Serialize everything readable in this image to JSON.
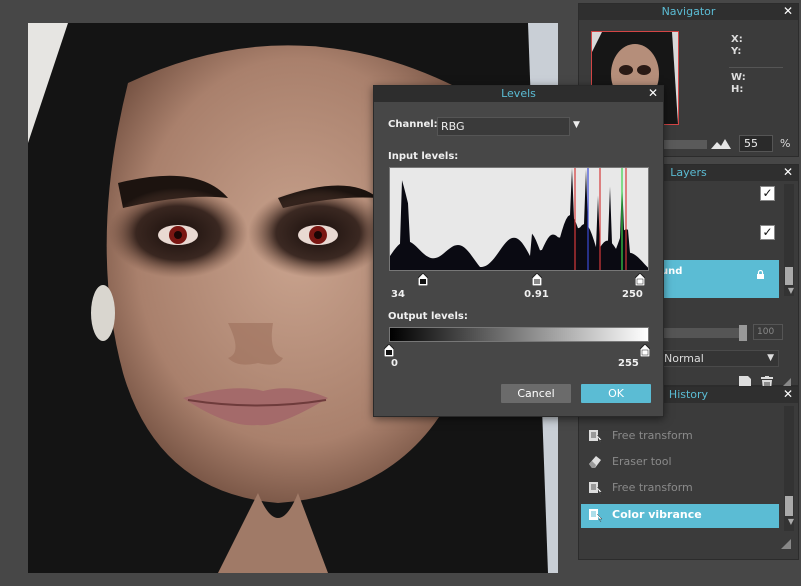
{
  "navigator": {
    "title": "Navigator",
    "labels": {
      "x": "X:",
      "y": "Y:",
      "w": "W:",
      "h": "H:"
    },
    "zoom_value": "55",
    "zoom_unit": "%"
  },
  "layers": {
    "title": "Layers",
    "background_layer_name": "und",
    "opacity_value": "100",
    "blend_mode": "Normal"
  },
  "history": {
    "title": "History",
    "items": [
      {
        "label": "Free transform"
      },
      {
        "label": "Eraser tool"
      },
      {
        "label": "Free transform"
      },
      {
        "label": "Color vibrance"
      }
    ],
    "active_index": 3
  },
  "levels": {
    "title": "Levels",
    "channel_label": "Channel:",
    "channel_value": "RBG",
    "input_label": "Input levels:",
    "input_black": "34",
    "input_gamma": "0.91",
    "input_white": "250",
    "input_black_level": 34,
    "input_gamma_level": 0.91,
    "input_white_level": 250,
    "output_label": "Output levels:",
    "output_black": "0",
    "output_white": "255",
    "output_black_level": 0,
    "output_white_level": 255,
    "cancel_label": "Cancel",
    "ok_label": "OK"
  },
  "colors": {
    "accent": "#5bbcd4",
    "panel_bg": "#3b3b3b",
    "workspace_bg": "#474747"
  }
}
